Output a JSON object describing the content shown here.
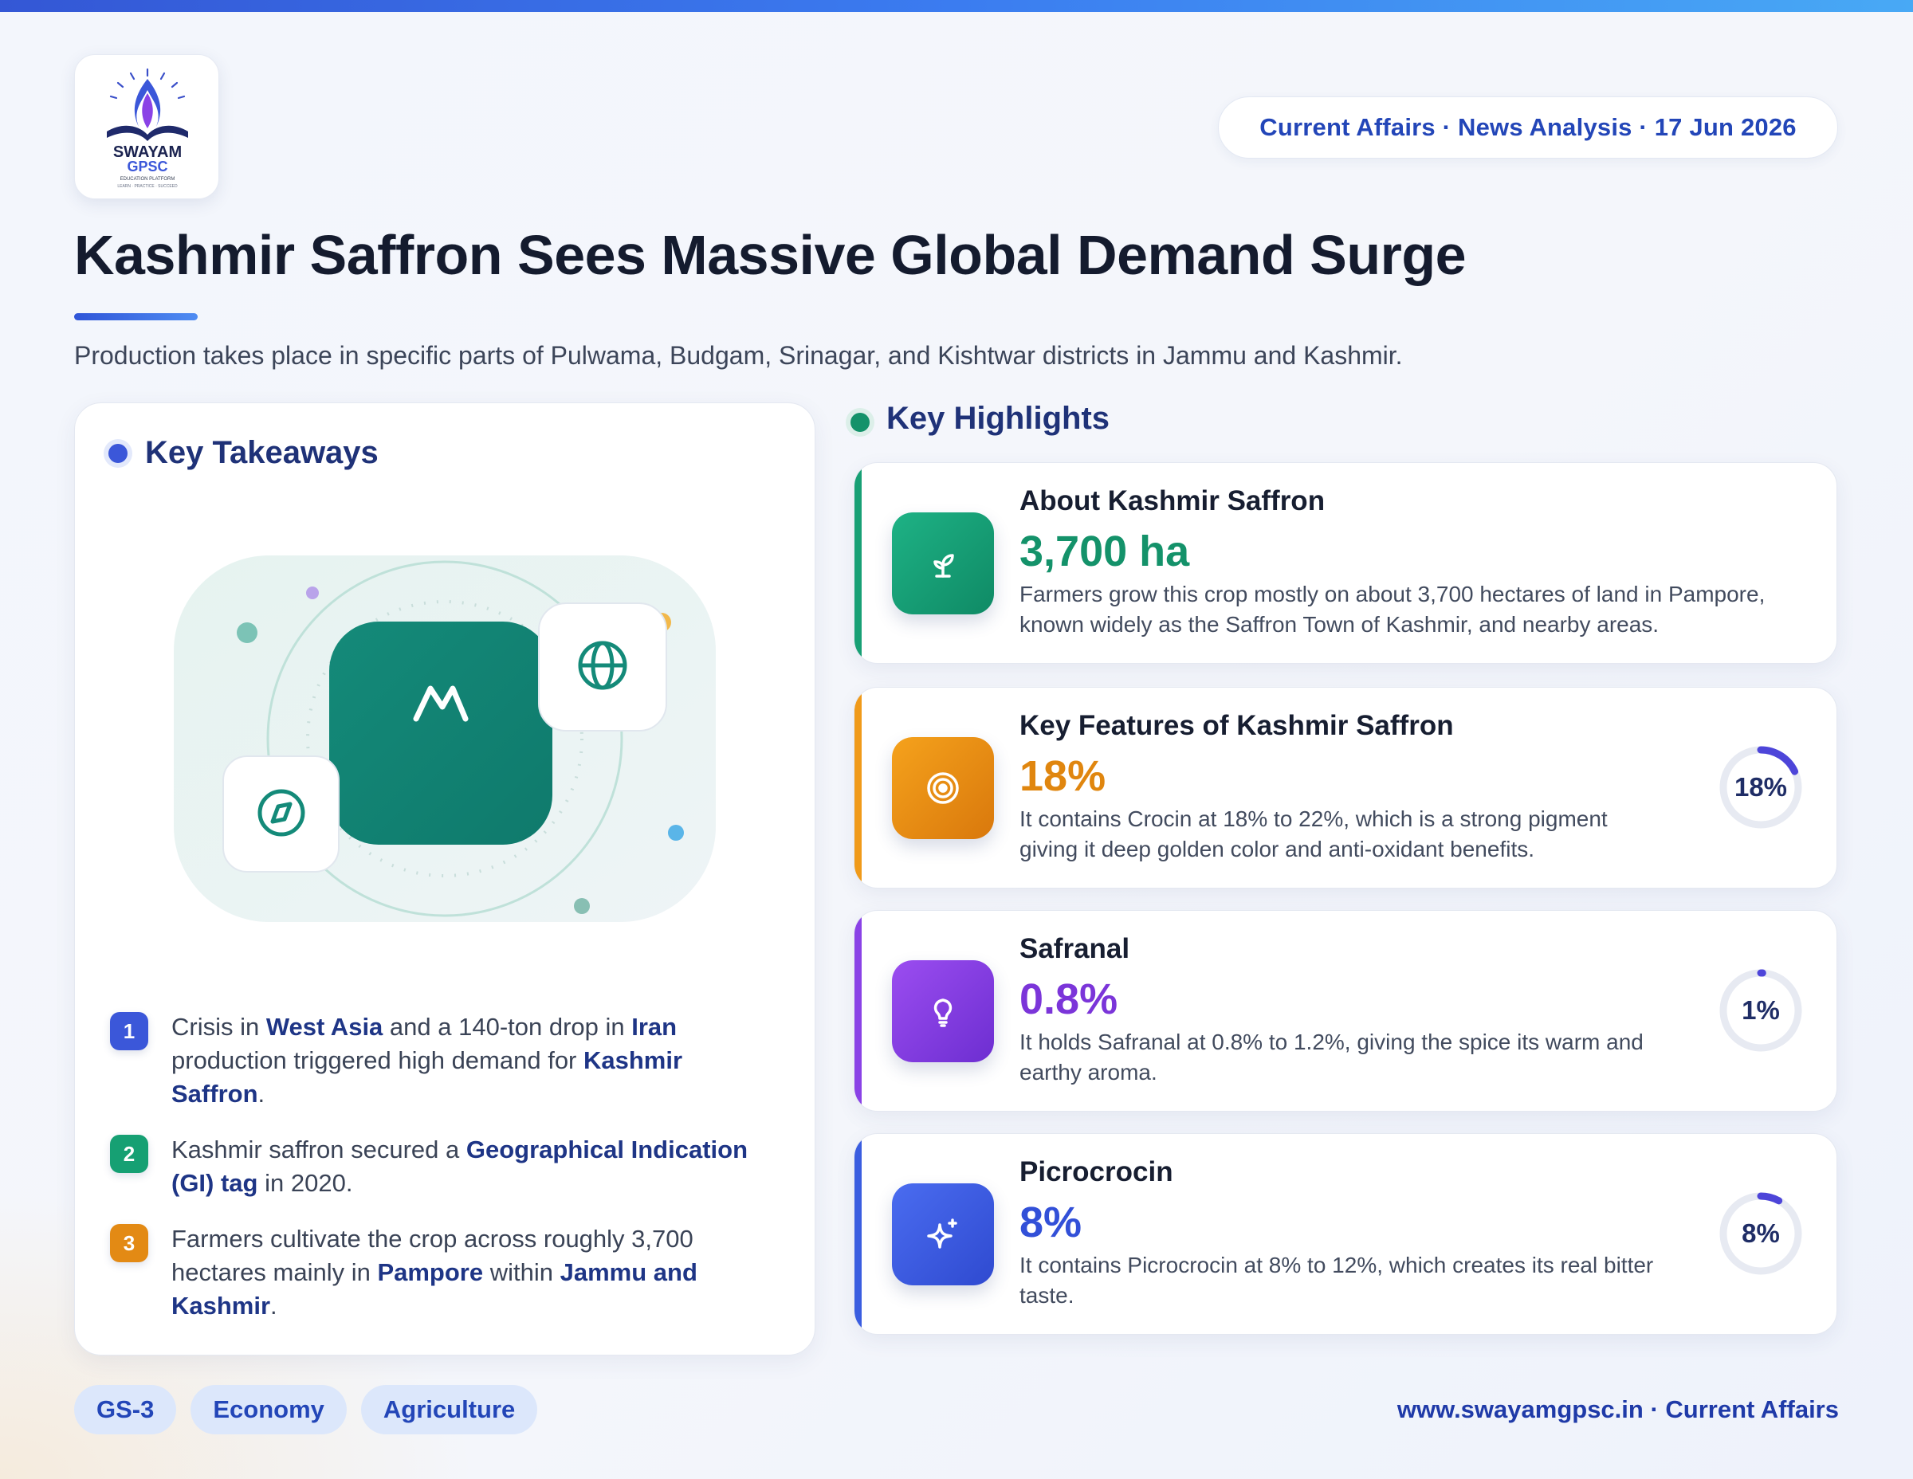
{
  "logo": {
    "line1": "SWAYAM",
    "line2": "GPSC",
    "line3": "EDUCATION PLATFORM",
    "line4": "LEARN · PRACTICE · SUCCEED"
  },
  "header": {
    "pill_text": "Current Affairs · News Analysis · 17 Jun 2026"
  },
  "title": "Kashmir Saffron Sees Massive Global Demand Surge",
  "subtitle": "Production takes place in specific parts of Pulwama, Budgam, Srinagar, and Kishtwar districts in Jammu and Kashmir.",
  "takeaways": {
    "heading": "Key Takeaways",
    "items": [
      {
        "num": "1",
        "color": "#3b57d9",
        "parts": [
          {
            "t": "Crisis in ",
            "b": false
          },
          {
            "t": "West Asia",
            "b": true
          },
          {
            "t": " and a 140-ton drop in ",
            "b": false
          },
          {
            "t": "Iran",
            "b": true
          },
          {
            "t": " production triggered high demand for ",
            "b": false
          },
          {
            "t": "Kashmir Saffron",
            "b": true
          },
          {
            "t": ".",
            "b": false
          }
        ]
      },
      {
        "num": "2",
        "color": "#16a073",
        "parts": [
          {
            "t": "Kashmir saffron secured a ",
            "b": false
          },
          {
            "t": "Geographical Indication (GI) tag",
            "b": true
          },
          {
            "t": " in 2020.",
            "b": false
          }
        ]
      },
      {
        "num": "3",
        "color": "#e38a14",
        "parts": [
          {
            "t": "Farmers cultivate the crop across roughly 3,700 hectares mainly in ",
            "b": false
          },
          {
            "t": "Pampore",
            "b": true
          },
          {
            "t": " within ",
            "b": false
          },
          {
            "t": "Jammu and Kashmir",
            "b": true
          },
          {
            "t": ".",
            "b": false
          }
        ]
      }
    ]
  },
  "highlights": {
    "heading": "Key Highlights",
    "cards": [
      {
        "title": "About Kashmir Saffron",
        "value": "3,700 ha",
        "value_color": "#14926a",
        "accent": "#18a075",
        "icon": "sprout-icon",
        "desc": "Farmers grow this crop mostly on about 3,700 hectares of land in Pampore, known widely as the Saffron Town of Kashmir, and nearby areas."
      },
      {
        "title": "Key Features of Kashmir Saffron",
        "value": "18%",
        "value_color": "#e0860f",
        "accent": "#f09a1a",
        "icon": "target-icon",
        "ring_label": "18%",
        "ring_fraction": 0.18,
        "desc": "It contains Crocin at 18% to 22%, which is a strong pigment giving it deep golden color and anti-oxidant benefits."
      },
      {
        "title": "Safranal",
        "value": "0.8%",
        "value_color": "#7b35d9",
        "accent": "#8a42e6",
        "icon": "lightbulb-icon",
        "ring_label": "1%",
        "ring_fraction": 0.008,
        "desc": "It holds Safranal at 0.8% to 1.2%, giving the spice its warm and earthy aroma."
      },
      {
        "title": "Picrocrocin",
        "value": "8%",
        "value_color": "#3250d8",
        "accent": "#3a5de0",
        "icon": "sparkle-icon",
        "ring_label": "8%",
        "ring_fraction": 0.08,
        "desc": "It contains Picrocrocin at 8% to 12%, which creates its real bitter taste."
      }
    ]
  },
  "tags": [
    "GS-3",
    "Economy",
    "Agriculture"
  ],
  "footer": {
    "link_text": "www.swayamgpsc.in · Current Affairs"
  }
}
